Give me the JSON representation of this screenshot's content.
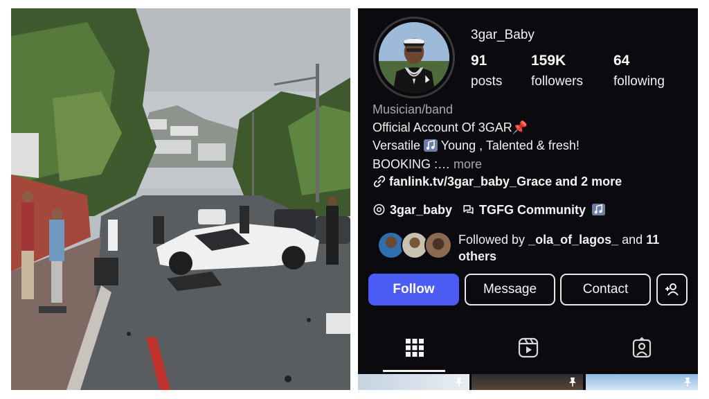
{
  "profile": {
    "username": "3gar_Baby",
    "stats": {
      "posts": {
        "value": "91",
        "label": "posts"
      },
      "followers": {
        "value": "159K",
        "label": "followers"
      },
      "following": {
        "value": "64",
        "label": "following"
      }
    },
    "category": "Musician/band",
    "bio": {
      "line1": "Official Account Of 3GAR",
      "line1_emoji": "📌",
      "line2_a": "Versatile",
      "line2_b": "Young , Talented & fresh!",
      "line3": "BOOKING :…",
      "more": "more"
    },
    "link": "fanlink.tv/3gar_baby_Grace and 2 more",
    "threads": "3gar_baby",
    "community": "TGFG Community",
    "followed_by": {
      "prefix": "Followed by",
      "user": "_ola_of_lagos_",
      "middle": "and",
      "count": "11",
      "suffix": "others"
    },
    "buttons": {
      "follow": "Follow",
      "message": "Message",
      "contact": "Contact"
    },
    "tabs": [
      "posts-grid",
      "reels",
      "tagged"
    ],
    "colors": {
      "background": "#0b0b0f",
      "follow_button": "#4b5cf5",
      "muted_text": "#a8a8a8"
    },
    "icons": [
      "link-icon",
      "threads-icon",
      "community-icon",
      "music-note-icon",
      "add-person-icon",
      "grid-icon",
      "reels-icon",
      "tagged-icon",
      "pin-icon"
    ]
  },
  "photo": {
    "subject": "car crash street scene"
  }
}
